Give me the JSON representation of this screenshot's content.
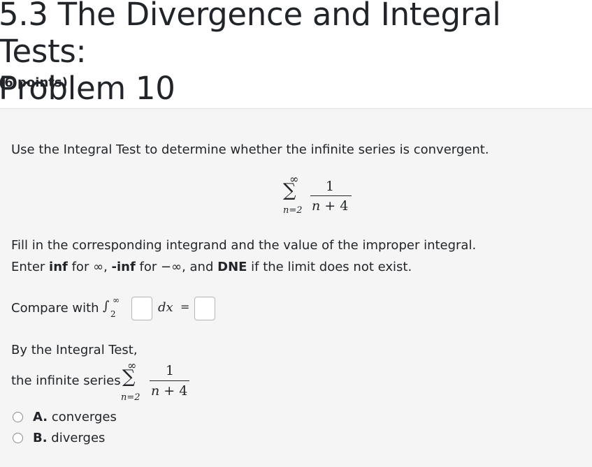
{
  "header": {
    "title_line1": "5.3 The Divergence and Integral Tests:",
    "title_line2": "Problem 10",
    "points": "(6 points)"
  },
  "problem": {
    "instruction": "Use the Integral Test to determine whether the infinite series is convergent.",
    "series": {
      "upper": "∞",
      "sigma": "∑",
      "lower": "n=2",
      "numerator": "1",
      "denominator_var": "n",
      "denominator_rest": " + 4"
    },
    "fill_in": "Fill in the corresponding integrand and the value of the improper integral.",
    "enter_prefix": "Enter ",
    "enter_inf": "inf",
    "enter_for1": " for ∞, ",
    "enter_neginf": "-inf",
    "enter_for2": " for −∞, and ",
    "enter_dne": "DNE",
    "enter_suffix": " if the limit does not exist.",
    "compare_label": "Compare with",
    "integral_sign": "∫",
    "integral_lower": "2",
    "integral_upper": "∞",
    "differential": "dx",
    "equals": "=",
    "integrand_value": "",
    "integral_value": "",
    "by_test": "By the Integral Test,",
    "the_series": "the infinite series",
    "options": [
      {
        "letter": "A.",
        "label": "converges",
        "selected": false
      },
      {
        "letter": "B.",
        "label": "diverges",
        "selected": false
      }
    ]
  }
}
